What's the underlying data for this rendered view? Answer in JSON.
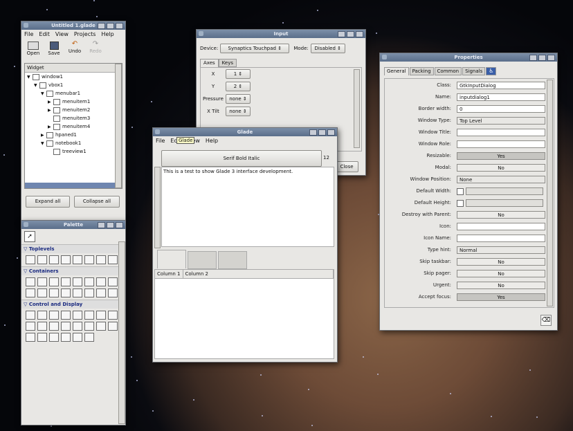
{
  "glade": {
    "title": "Untitled 1.glade",
    "menu": [
      "File",
      "Edit",
      "View",
      "Projects",
      "Help"
    ],
    "toolbar": {
      "open": "Open",
      "save": "Save",
      "undo": "Undo",
      "redo": "Redo"
    },
    "widget_header": "Widget",
    "tree": [
      {
        "label": "window1",
        "indent": 0,
        "arrow": "▼"
      },
      {
        "label": "vbox1",
        "indent": 1,
        "arrow": "▼"
      },
      {
        "label": "menubar1",
        "indent": 2,
        "arrow": "▼"
      },
      {
        "label": "menuitem1",
        "indent": 3,
        "arrow": "▶"
      },
      {
        "label": "menuitem2",
        "indent": 3,
        "arrow": "▶"
      },
      {
        "label": "menuitem3",
        "indent": 3,
        "arrow": ""
      },
      {
        "label": "menuitem4",
        "indent": 3,
        "arrow": "▶"
      },
      {
        "label": "hpaned1",
        "indent": 2,
        "arrow": "▶"
      },
      {
        "label": "notebook1",
        "indent": 2,
        "arrow": "▼"
      },
      {
        "label": "treeview1",
        "indent": 3,
        "arrow": ""
      }
    ],
    "expand_all": "Expand all",
    "collapse_all": "Collapse all"
  },
  "palette": {
    "title": "Palette",
    "sections": [
      {
        "label": "Toplevels",
        "count": 8
      },
      {
        "label": "Containers",
        "count": 16
      },
      {
        "label": "Control and Display",
        "count": 22
      }
    ]
  },
  "input": {
    "title": "Input",
    "device_label": "Device:",
    "device_value": "Synaptics Touchpad",
    "mode_label": "Mode:",
    "mode_value": "Disabled",
    "tabs": [
      "Axes",
      "Keys"
    ],
    "axes": [
      {
        "label": "X",
        "value": "1"
      },
      {
        "label": "Y",
        "value": "2"
      },
      {
        "label": "Pressure",
        "value": "none"
      },
      {
        "label": "X Tilt",
        "value": "none"
      }
    ],
    "close": "Close"
  },
  "gladewin": {
    "title": "Glade",
    "menu": [
      "File",
      "Edit",
      "View",
      "Help"
    ],
    "tooltip": "Glade",
    "font_button": "Serif Bold Italic",
    "font_size": "12",
    "text": "This is a test to show Glade 3 interface development.",
    "columns": [
      "Column 1",
      "Column 2"
    ]
  },
  "properties": {
    "title": "Properties",
    "tabs": [
      "General",
      "Packing",
      "Common",
      "Signals"
    ],
    "rows": [
      {
        "label": "Class:",
        "value": "GtkInputDialog",
        "kind": "field"
      },
      {
        "label": "Name:",
        "value": "inputdialog1",
        "kind": "field"
      },
      {
        "label": "Border width:",
        "value": "0",
        "kind": "spin"
      },
      {
        "label": "Window Type:",
        "value": "Top Level",
        "kind": "combo"
      },
      {
        "label": "Window Title:",
        "value": "",
        "kind": "field"
      },
      {
        "label": "Window Role:",
        "value": "",
        "kind": "field"
      },
      {
        "label": "Resizable:",
        "value": "Yes",
        "kind": "toggle-on"
      },
      {
        "label": "Modal:",
        "value": "No",
        "kind": "toggle"
      },
      {
        "label": "Window Position:",
        "value": "None",
        "kind": "combo"
      },
      {
        "label": "Default Width:",
        "value": "",
        "kind": "check"
      },
      {
        "label": "Default Height:",
        "value": "",
        "kind": "check"
      },
      {
        "label": "Destroy with Parent:",
        "value": "No",
        "kind": "toggle"
      },
      {
        "label": "Icon:",
        "value": "",
        "kind": "field"
      },
      {
        "label": "Icon Name:",
        "value": "",
        "kind": "field"
      },
      {
        "label": "Type hint:",
        "value": "Normal",
        "kind": "combo"
      },
      {
        "label": "Skip taskbar:",
        "value": "No",
        "kind": "toggle"
      },
      {
        "label": "Skip pager:",
        "value": "No",
        "kind": "toggle"
      },
      {
        "label": "Urgent:",
        "value": "No",
        "kind": "toggle"
      },
      {
        "label": "Accept focus:",
        "value": "Yes",
        "kind": "toggle-on"
      }
    ]
  }
}
